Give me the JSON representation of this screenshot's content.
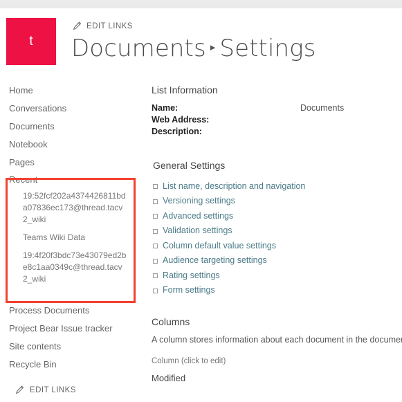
{
  "colors": {
    "logo_red": "#ed1144",
    "annotation_red": "#f4402f",
    "link_teal": "#4b7b88",
    "suite_bar": "#ebebeb"
  },
  "header": {
    "logo_letter": "t",
    "edit_links_label": "EDIT LINKS",
    "breadcrumb": {
      "parent": "Documents",
      "separator": "▸",
      "current": "Settings"
    }
  },
  "sidebar": {
    "top_items": [
      {
        "label": "Home"
      },
      {
        "label": "Conversations"
      },
      {
        "label": "Documents"
      },
      {
        "label": "Notebook"
      },
      {
        "label": "Pages"
      }
    ],
    "recent": {
      "heading": "Recent",
      "items": [
        {
          "label": "19:52fcf202a4374426811bda07836ec173@thread.tacv2_wiki"
        },
        {
          "label": "Teams Wiki Data"
        },
        {
          "label": "19:4f20f3bdc73e43079ed2be8c1aa0349c@thread.tacv2_wiki"
        }
      ]
    },
    "bottom_items": [
      {
        "label": "Process Documents"
      },
      {
        "label": "Project Bear Issue tracker"
      },
      {
        "label": "Site contents"
      },
      {
        "label": "Recycle Bin"
      }
    ],
    "edit_links_label": "EDIT LINKS"
  },
  "main": {
    "list_information": {
      "heading": "List Information",
      "rows": [
        {
          "label": "Name:",
          "value": "Documents"
        },
        {
          "label": "Web Address:",
          "value": ""
        },
        {
          "label": "Description:",
          "value": ""
        }
      ]
    },
    "general_settings": {
      "heading": "General Settings",
      "links": [
        {
          "label": "List name, description and navigation"
        },
        {
          "label": "Versioning settings"
        },
        {
          "label": "Advanced settings"
        },
        {
          "label": "Validation settings"
        },
        {
          "label": "Column default value settings"
        },
        {
          "label": "Audience targeting settings"
        },
        {
          "label": "Rating settings"
        },
        {
          "label": "Form settings"
        }
      ]
    },
    "columns": {
      "heading": "Columns",
      "description": "A column stores information about each document in the document li",
      "table_header": "Column (click to edit)",
      "rows": [
        {
          "name": "Modified"
        }
      ]
    }
  }
}
